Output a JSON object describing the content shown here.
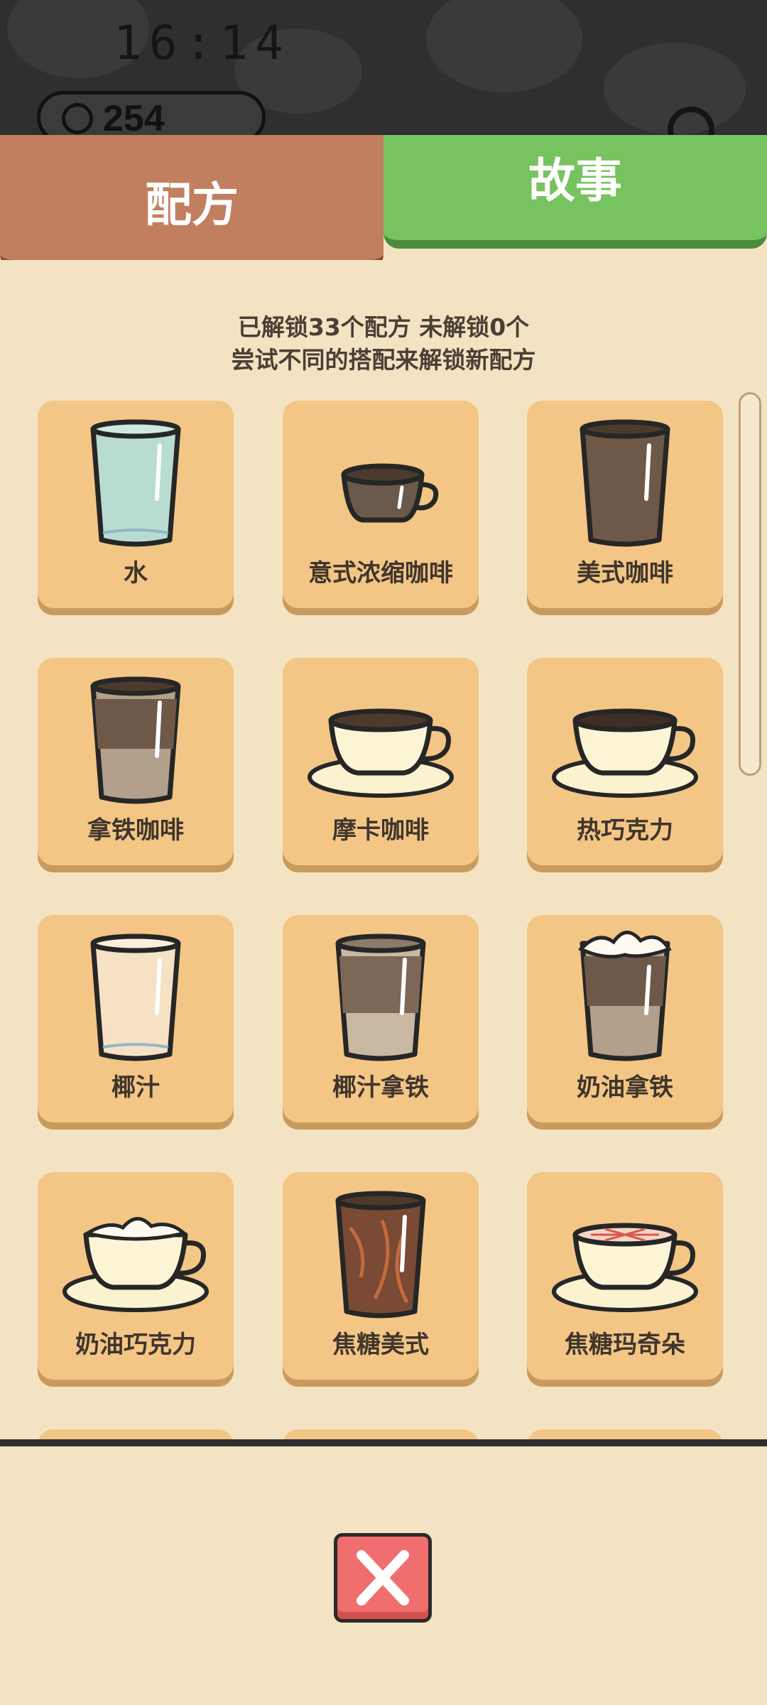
{
  "hud": {
    "clock": "16:14",
    "coins": "254"
  },
  "tabs": {
    "recipe": "配方",
    "story": "故事"
  },
  "info": {
    "line1": "已解锁33个配方 未解锁0个",
    "line2": "尝试不同的搭配来解锁新配方"
  },
  "recipes": [
    {
      "name": "水",
      "icon": "water-glass-icon"
    },
    {
      "name": "意式浓缩咖啡",
      "icon": "espresso-cup-icon"
    },
    {
      "name": "美式咖啡",
      "icon": "americano-glass-icon"
    },
    {
      "name": "拿铁咖啡",
      "icon": "latte-glass-icon"
    },
    {
      "name": "摩卡咖啡",
      "icon": "mocha-cup-icon"
    },
    {
      "name": "热巧克力",
      "icon": "hot-chocolate-cup-icon"
    },
    {
      "name": "椰汁",
      "icon": "coconut-milk-glass-icon"
    },
    {
      "name": "椰汁拿铁",
      "icon": "coconut-latte-glass-icon"
    },
    {
      "name": "奶油拿铁",
      "icon": "cream-latte-glass-icon"
    },
    {
      "name": "奶油巧克力",
      "icon": "cream-chocolate-cup-icon"
    },
    {
      "name": "焦糖美式",
      "icon": "caramel-americano-glass-icon"
    },
    {
      "name": "焦糖玛奇朵",
      "icon": "caramel-macchiato-cup-icon"
    }
  ],
  "colors": {
    "panel_bg": "#f3e3c3",
    "card_bg": "#f3c686",
    "recipe_tab": "#c17f60",
    "story_tab": "#77c35f",
    "close_button": "#f06e6e"
  }
}
